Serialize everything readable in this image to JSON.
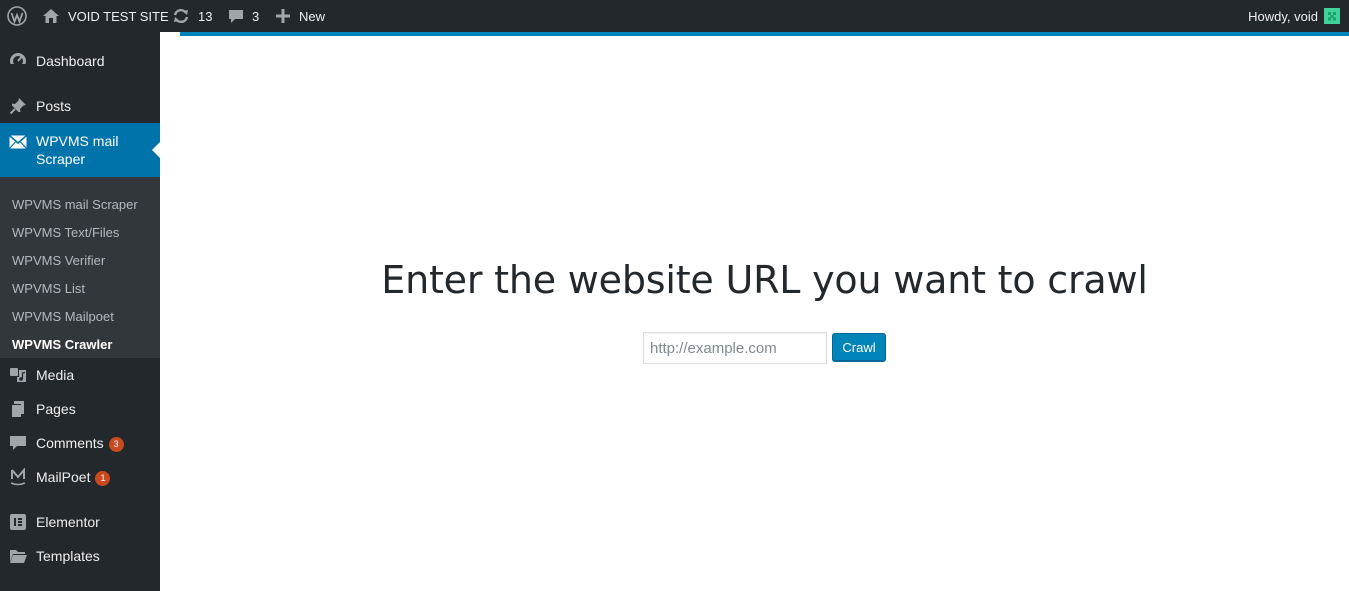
{
  "admin_bar": {
    "site_name": "VOID TEST SITE",
    "updates_count": "13",
    "comments_count": "3",
    "new_label": "New",
    "greeting": "Howdy, void"
  },
  "sidebar": {
    "dashboard": "Dashboard",
    "posts": "Posts",
    "active_menu": "WPVMS mail Scraper",
    "submenu": [
      "WPVMS mail Scraper",
      "WPVMS Text/Files",
      "WPVMS Verifier",
      "WPVMS List",
      "WPVMS Mailpoet",
      "WPVMS Crawler"
    ],
    "current_submenu": "WPVMS Crawler",
    "media": "Media",
    "pages": "Pages",
    "comments": "Comments",
    "comments_badge": "3",
    "mailpoet": "MailPoet",
    "mailpoet_badge": "1",
    "elementor": "Elementor",
    "templates": "Templates"
  },
  "main": {
    "heading": "Enter the website URL you want to crawl",
    "url_placeholder": "http://example.com",
    "url_value": "",
    "crawl_button": "Crawl"
  },
  "colors": {
    "admin_bar_bg": "#23282d",
    "active_menu_bg": "#0073aa",
    "submenu_bg": "#32373c",
    "button_bg": "#0085ba",
    "badge_bg": "#ca4a1f"
  }
}
